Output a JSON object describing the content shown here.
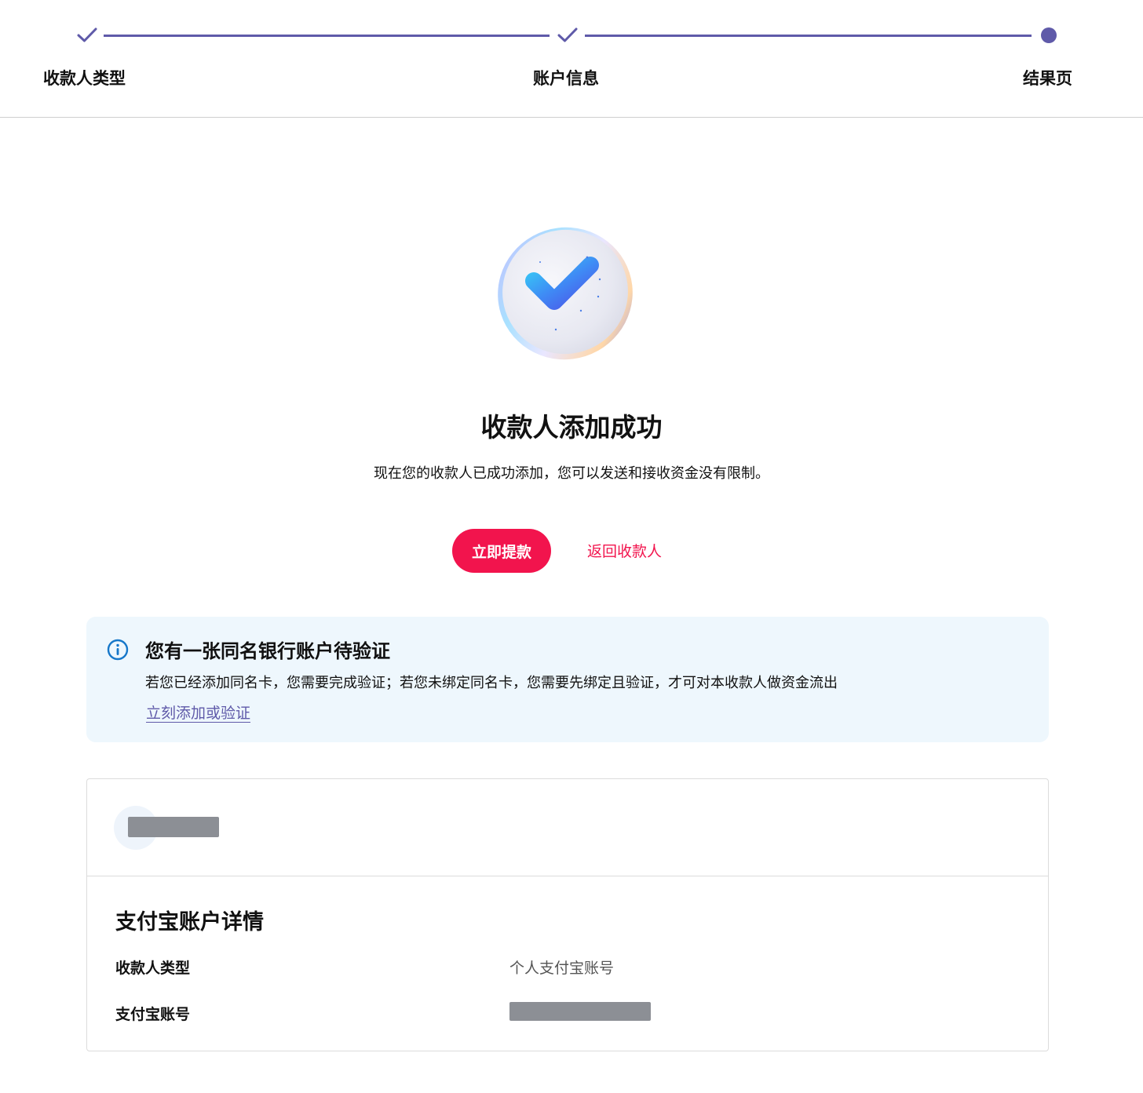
{
  "colors": {
    "accent_purple": "#5f5aa9",
    "primary_red": "#f2144d",
    "notice_bg": "#eef7fd",
    "info_blue": "#1677c9"
  },
  "stepper": {
    "steps": [
      {
        "label": "收款人类型",
        "state": "completed",
        "icon": "check-icon"
      },
      {
        "label": "账户信息",
        "state": "completed",
        "icon": "check-icon"
      },
      {
        "label": "结果页",
        "state": "current",
        "icon": "current-dot"
      }
    ]
  },
  "result": {
    "icon": "success-check-illustration",
    "title": "收款人添加成功",
    "subtitle": "现在您的收款人已成功添加，您可以发送和接收资金没有限制。",
    "primary_button": "立即提款",
    "secondary_link": "返回收款人"
  },
  "notice": {
    "icon": "info-circle-icon",
    "title": "您有一张同名银行账户待验证",
    "body": "若您已经添加同名卡，您需要完成验证；若您未绑定同名卡，您需要先绑定且验证，才可对本收款人做资金流出",
    "link": "立刻添加或验证"
  },
  "details": {
    "header_name": "[redacted]",
    "section_title": "支付宝账户详情",
    "rows": [
      {
        "label": "收款人类型",
        "value": "个人支付宝账号"
      },
      {
        "label": "支付宝账号",
        "value": "[redacted]"
      }
    ]
  }
}
